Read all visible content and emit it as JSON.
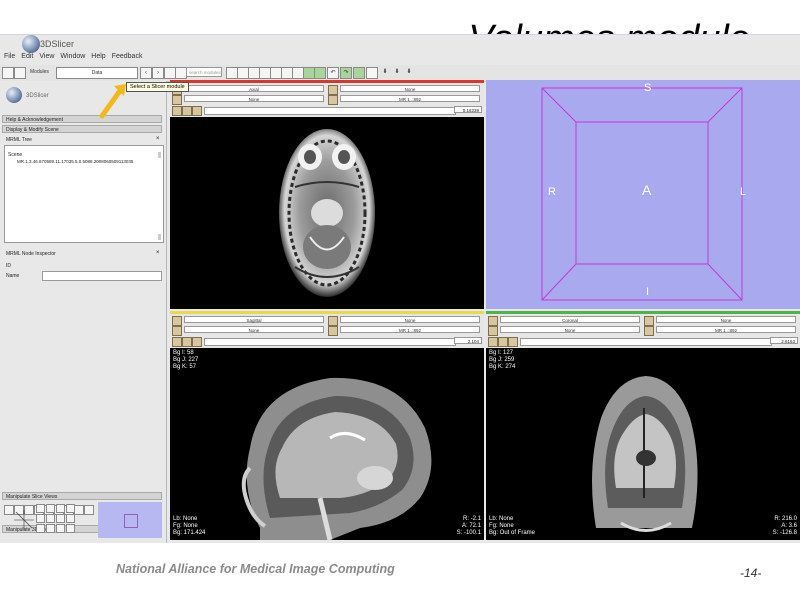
{
  "slide": {
    "title": "Volumes module",
    "footer": "National Alliance for Medical Image Computing",
    "page": "-14-"
  },
  "app": {
    "name": "3DSlicer",
    "menu": [
      "File",
      "Edit",
      "View",
      "Window",
      "Help",
      "Feedback"
    ],
    "modules_label": "Modules",
    "module_selected": "Data",
    "search_placeholder": "search modules",
    "tooltip": "Select a Slicer module"
  },
  "panel": {
    "logo_text": "3DSlicer",
    "help": "Help & Acknowledgement",
    "display_modify": "Display & Modify Scene",
    "mrml_tree": "MRML Tree",
    "scene": "Scene",
    "tree_item": "MR.1.3.46.670589.11.17035.5.0.5088.2008060509113035",
    "node_inspector": "MRML Node Inspector",
    "id_label": "ID",
    "name_label": "Name",
    "manip_slice": "Manipulate Slice Views",
    "manip_3d": "Manipulate 3D View"
  },
  "viewers": {
    "red": {
      "orientation": "Axial",
      "bg": "None",
      "fg": "MR 1 .:892",
      "fg2": "None",
      "value": "0.16239"
    },
    "yellow": {
      "orientation": "Sagittal",
      "bg": "None",
      "fg": "MR 1 .:892",
      "fg2": "None",
      "value": "2.104"
    },
    "green": {
      "orientation": "Coronal",
      "bg": "None",
      "fg": "MR 1 .:892",
      "fg2": "None",
      "value": "2.6163"
    },
    "sag_tl": "Bg I: 58\nBg J: 227\nBg K: 57",
    "sag_bl": "Lb: None\nFg: None\nBg: 171.424",
    "sag_br": "R: -2.1\nA: 72.1\nS: -100.1",
    "cor_tl": "Bg I: 127\nBg J: 259\nBg K: 274",
    "cor_bl": "Lb: None\nFg: None\nBg: Out of Frame",
    "cor_br": "R: 216.0\nA: 3.6\nS: -126.8",
    "three_d": {
      "S": "S",
      "I": "I",
      "R": "R",
      "L": "L",
      "A": "A"
    }
  },
  "colors": {
    "red_bar": "#d9372b",
    "yellow_bar": "#e8d84a",
    "green_bar": "#4fb447",
    "three_d_bg": "#a9a9ef",
    "arrow": "#f3b81c"
  }
}
